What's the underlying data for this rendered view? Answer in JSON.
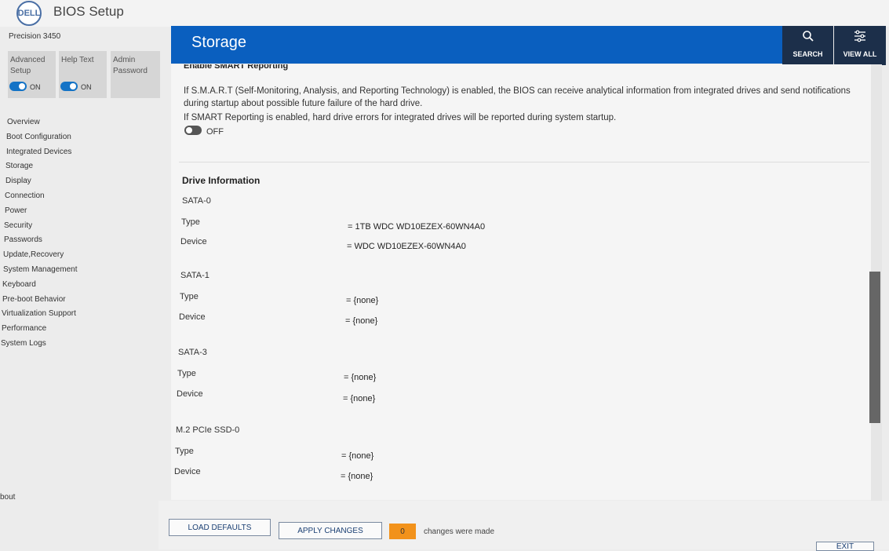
{
  "header": {
    "logo_text": "DELL",
    "app_title": "BIOS Setup",
    "model": "Precision 3450"
  },
  "quick_toggles": [
    {
      "label": "Advanced Setup",
      "state": "ON"
    },
    {
      "label": "Help Text",
      "state": "ON"
    },
    {
      "label": "Admin Password",
      "state": ""
    }
  ],
  "sidebar": {
    "items": [
      "Overview",
      "Boot Configuration",
      "Integrated Devices",
      "Storage",
      "Display",
      "Connection",
      "Power",
      "Security",
      "Passwords",
      "Update,Recovery",
      "System Management",
      "Keyboard",
      "Pre-boot Behavior",
      "Virtualization Support",
      "Performance",
      "System Logs"
    ],
    "about_label": "bout"
  },
  "page": {
    "title": "Storage",
    "search_label": "SEARCH",
    "view_all_label": "VIEW ALL"
  },
  "smart": {
    "heading": "Enable SMART Reporting",
    "desc1": "If S.M.A.R.T (Self-Monitoring, Analysis, and Reporting Technology) is enabled, the BIOS can receive analytical information from integrated drives and send notifications during startup about possible future failure of the hard drive.",
    "desc2": "If SMART Reporting is enabled, hard drive errors for integrated drives will be reported during system startup.",
    "state": "OFF"
  },
  "drive_info": {
    "title": "Drive Information",
    "type_label": "Type",
    "device_label": "Device",
    "drives": [
      {
        "name": "SATA-0",
        "type": "= 1TB WDC WD10EZEX-60WN4A0",
        "device": "= WDC WD10EZEX-60WN4A0"
      },
      {
        "name": "SATA-1",
        "type": "= {none}",
        "device": "= {none}"
      },
      {
        "name": "SATA-3",
        "type": "= {none}",
        "device": "= {none}"
      },
      {
        "name": "M.2 PCIe SSD-0",
        "type": "= {none}",
        "device": "= {none}"
      }
    ]
  },
  "footer": {
    "load_defaults": "LOAD DEFAULTS",
    "apply_changes": "APPLY CHANGES",
    "changes_count": "0",
    "changes_text": "changes were made",
    "exit_label": "EXIT"
  },
  "colors": {
    "banner": "#0a5fbf",
    "toolbar": "#1c2f4a",
    "toggle_on": "#1473c6",
    "badge": "#f2921b"
  }
}
